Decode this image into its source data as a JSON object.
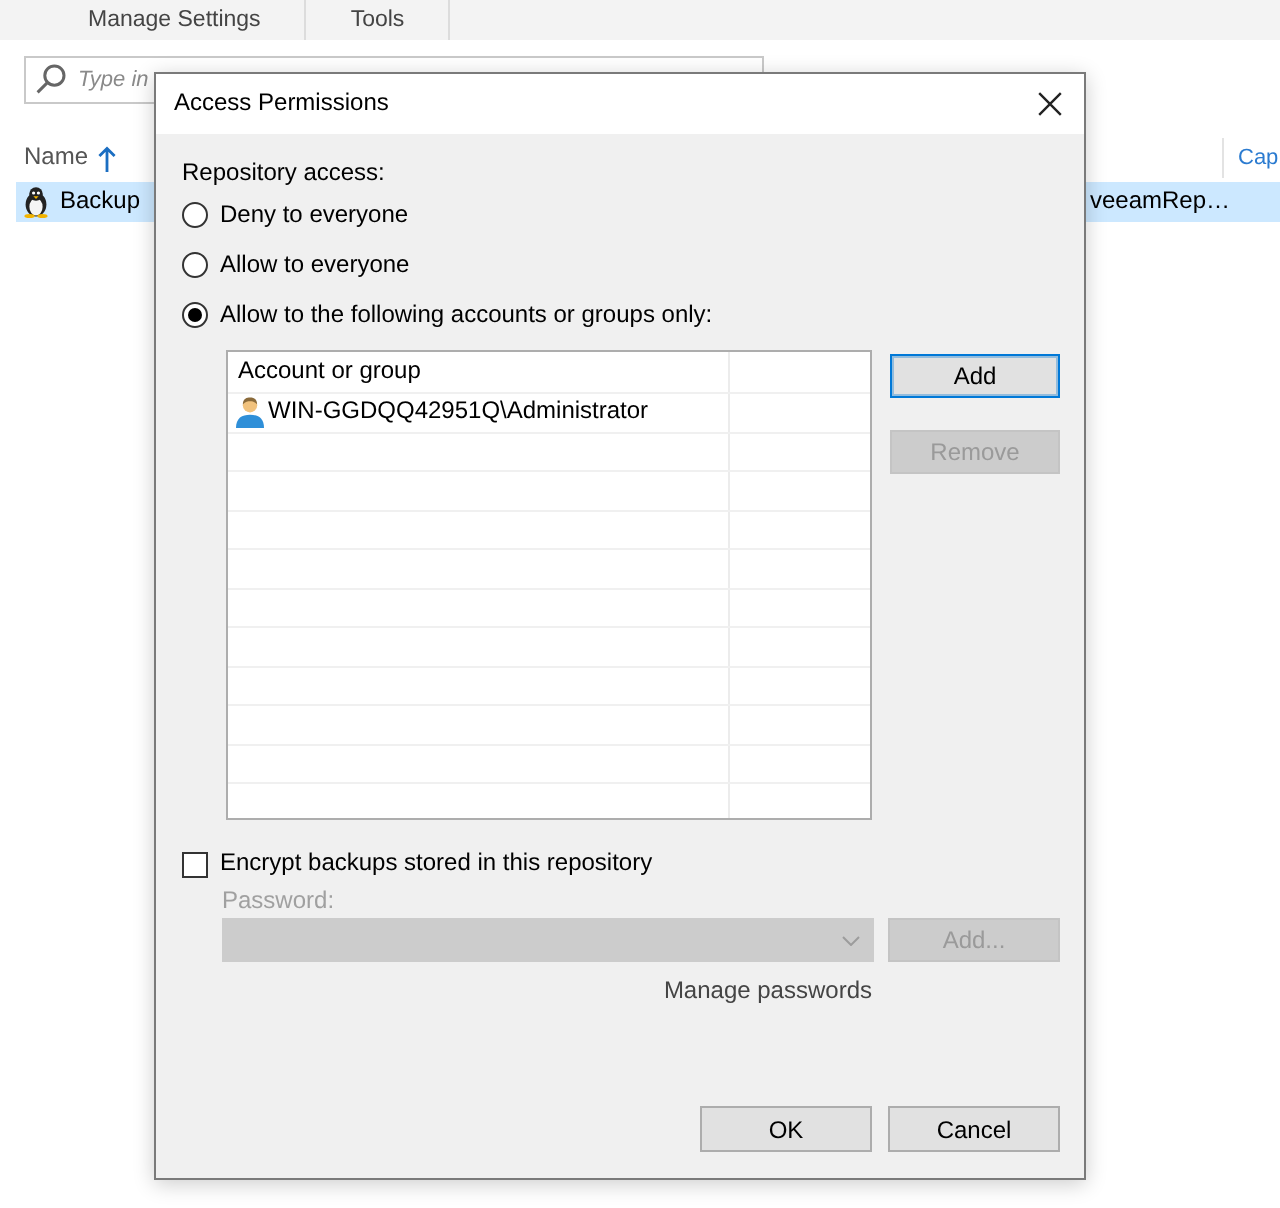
{
  "ribbon": {
    "tabs": [
      {
        "label": "Manage Settings",
        "selected": false
      },
      {
        "label": "Tools",
        "selected": false
      }
    ]
  },
  "search": {
    "placeholder": "Type in"
  },
  "table": {
    "columns": [
      {
        "label": "Name",
        "sorted_ascending": true
      },
      {
        "label": "Cap"
      }
    ],
    "rows": [
      {
        "selected": true,
        "cells": [
          "Backup",
          "veeamRep…"
        ]
      }
    ]
  },
  "dialog": {
    "title": "Access Permissions",
    "repository_access": {
      "label": "Repository access:",
      "options": [
        {
          "label": "Deny to everyone",
          "selected": false
        },
        {
          "label": "Allow to everyone",
          "selected": false
        },
        {
          "label": "Allow to the following accounts or groups only:",
          "selected": true
        }
      ]
    },
    "accounts": {
      "column": "Account or group",
      "items": [
        {
          "name": "WIN-GGDQQ42951Q\\Administrator",
          "selected": false
        }
      ]
    },
    "account_buttons": [
      {
        "label": "Add",
        "focused": true,
        "disabled": false
      },
      {
        "label": "Remove",
        "focused": false,
        "disabled": true
      }
    ],
    "encryption": {
      "label": "Encrypt backups stored in this repository",
      "checked": false,
      "password_label": "Password:",
      "add_button": "Add...",
      "manage_link": "Manage passwords"
    },
    "buttons": [
      {
        "label": "OK"
      },
      {
        "label": "Cancel"
      }
    ]
  }
}
